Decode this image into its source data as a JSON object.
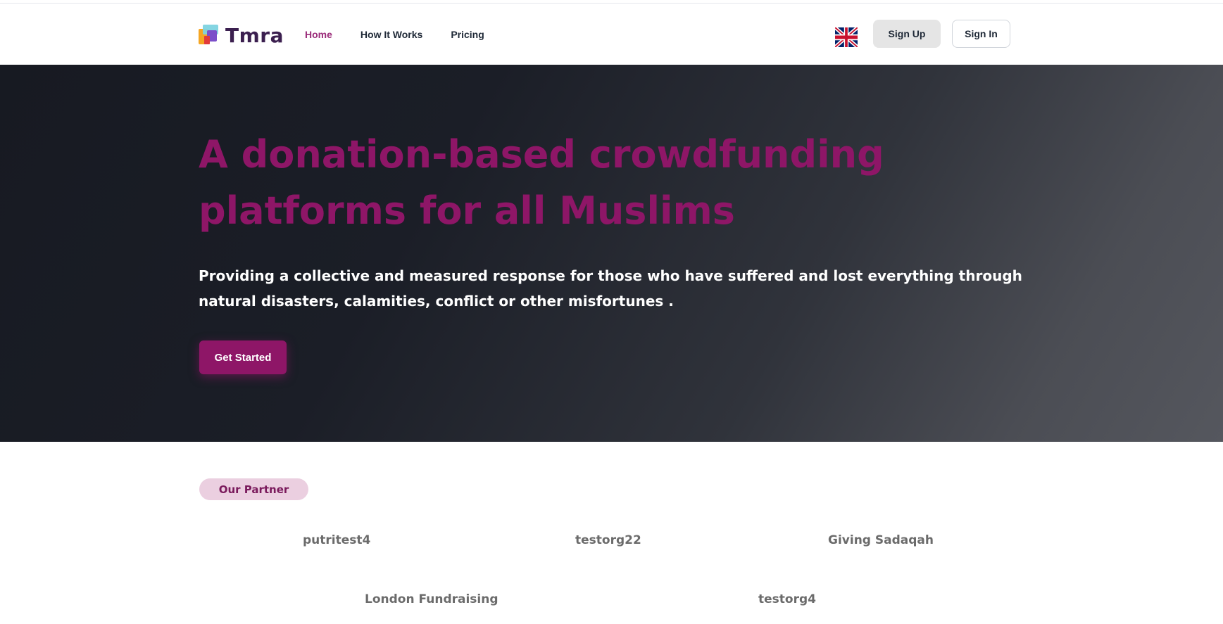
{
  "brand": {
    "name": "Tmra",
    "colors": {
      "primary": "#8e1667",
      "nav_active": "#9b2c7a",
      "badge_bg": "#ebcfe0"
    }
  },
  "nav": {
    "links": [
      {
        "label": "Home",
        "active": true
      },
      {
        "label": "How It Works",
        "active": false
      },
      {
        "label": "Pricing",
        "active": false
      }
    ],
    "language_icon": "uk-flag-icon",
    "signup_label": "Sign Up",
    "signin_label": "Sign In"
  },
  "hero": {
    "title": "A donation-based crowdfunding platforms for all Muslims",
    "subtitle": "Providing a collective and measured response for those who have suffered and lost everything through natural disasters, calamities, conflict or other misfortunes .",
    "cta_label": "Get Started"
  },
  "partners": {
    "badge": "Our Partner",
    "items": [
      {
        "name": "putritest4"
      },
      {
        "name": "testorg22"
      },
      {
        "name": "Giving Sadaqah"
      },
      {
        "name": "London Fundraising"
      },
      {
        "name": "testorg4"
      }
    ]
  }
}
